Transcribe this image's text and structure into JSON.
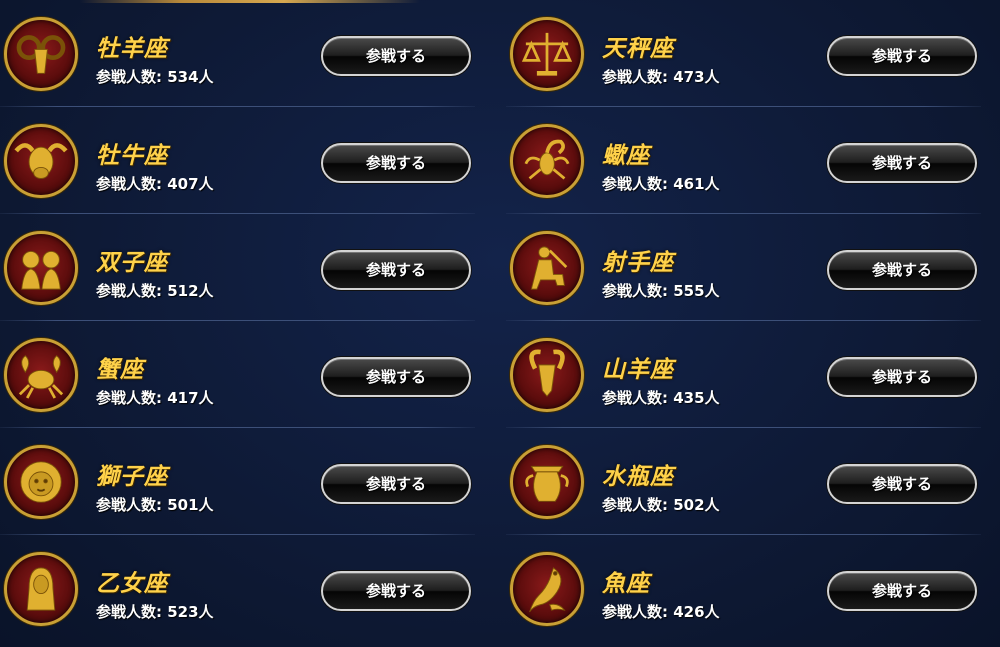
{
  "theme": {
    "gold": "#ffd24a",
    "emblem_red": "#6e1212",
    "background": "#0e1a35"
  },
  "button_label": "参戦する",
  "count_prefix": "参戦人数: ",
  "count_suffix": "人",
  "left": [
    {
      "name": "牡羊座",
      "count": "参戦人数: 534人",
      "icon": "aries-emblem-icon"
    },
    {
      "name": "牡牛座",
      "count": "参戦人数: 407人",
      "icon": "taurus-emblem-icon"
    },
    {
      "name": "双子座",
      "count": "参戦人数: 512人",
      "icon": "gemini-emblem-icon"
    },
    {
      "name": "蟹座",
      "count": "参戦人数: 417人",
      "icon": "cancer-emblem-icon"
    },
    {
      "name": "獅子座",
      "count": "参戦人数: 501人",
      "icon": "leo-emblem-icon"
    },
    {
      "name": "乙女座",
      "count": "参戦人数: 523人",
      "icon": "virgo-emblem-icon"
    }
  ],
  "right": [
    {
      "name": "天秤座",
      "count": "参戦人数: 473人",
      "icon": "libra-emblem-icon"
    },
    {
      "name": "蠍座",
      "count": "参戦人数: 461人",
      "icon": "scorpio-emblem-icon"
    },
    {
      "name": "射手座",
      "count": "参戦人数: 555人",
      "icon": "sagittarius-emblem-icon"
    },
    {
      "name": "山羊座",
      "count": "参戦人数: 435人",
      "icon": "capricorn-emblem-icon"
    },
    {
      "name": "水瓶座",
      "count": "参戦人数: 502人",
      "icon": "aquarius-emblem-icon"
    },
    {
      "name": "魚座",
      "count": "参戦人数: 426人",
      "icon": "pisces-emblem-icon"
    }
  ]
}
